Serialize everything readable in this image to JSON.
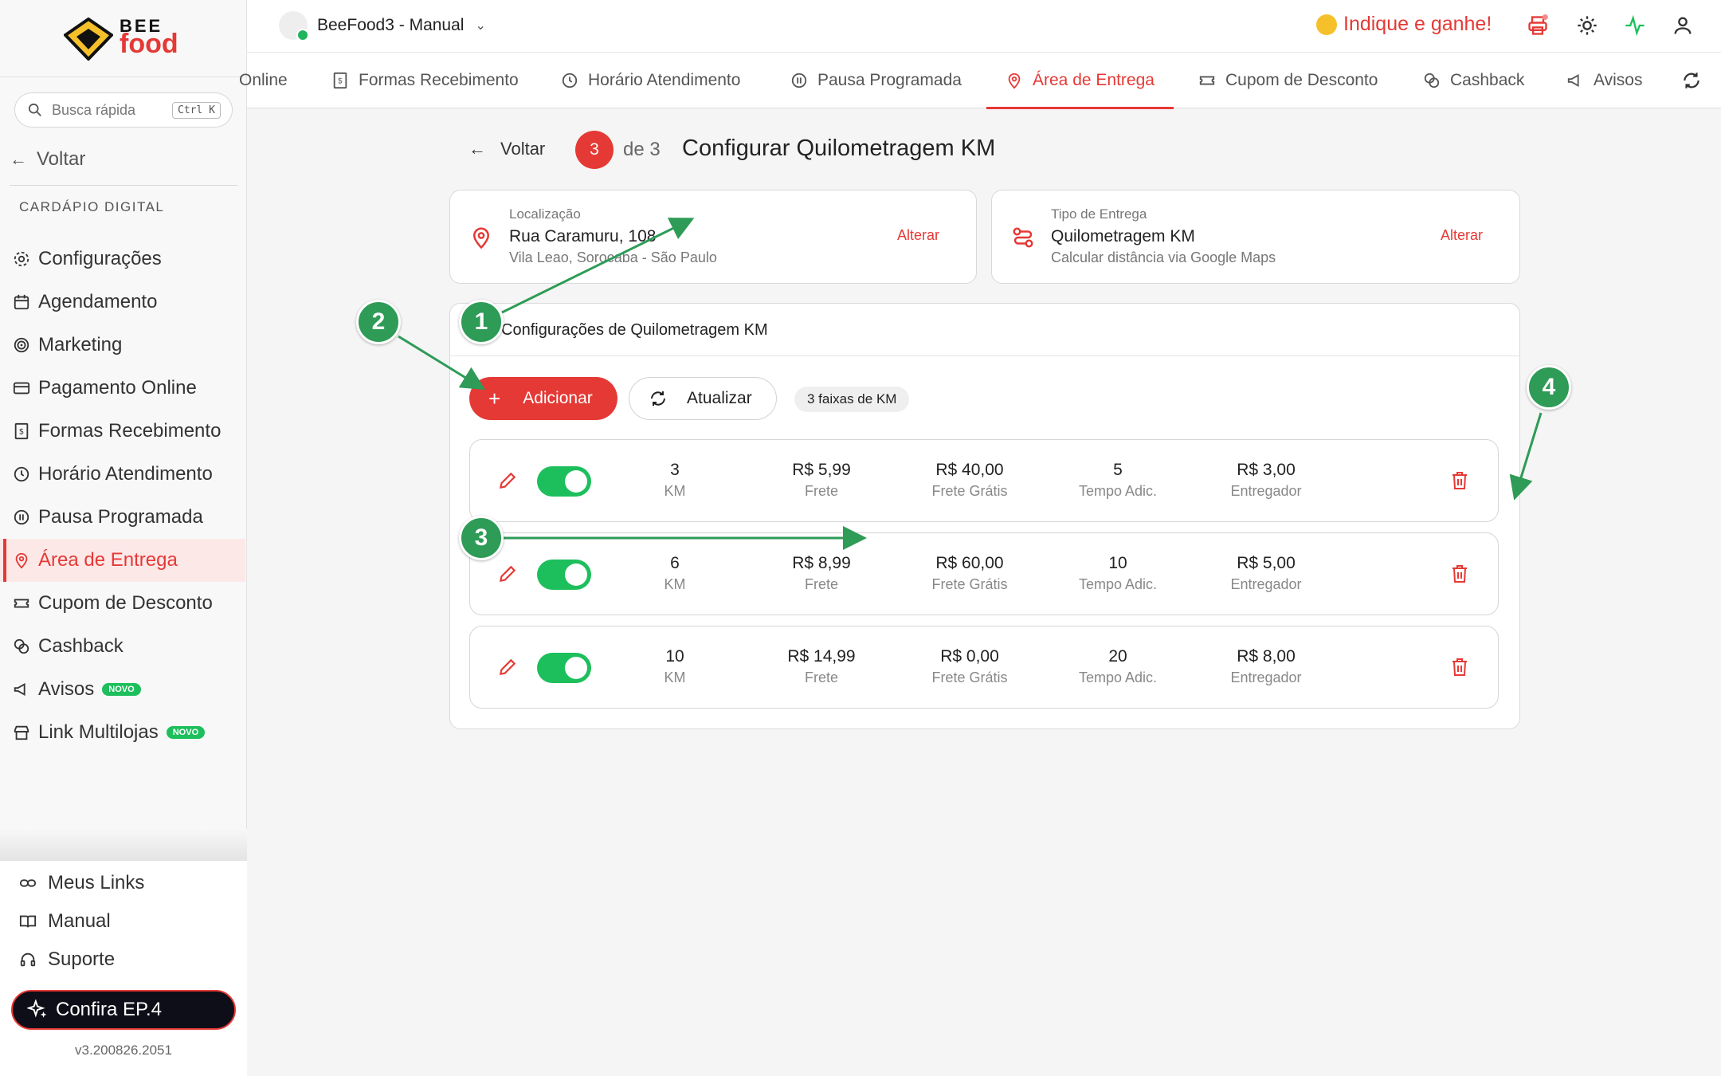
{
  "sidebar": {
    "logo_top": "BEE",
    "logo_bottom": "food",
    "search_placeholder": "Busca rápida",
    "search_shortcut": "Ctrl K",
    "back_label": "Voltar",
    "section_label": "CARDÁPIO DIGITAL",
    "items": [
      {
        "label": "Configurações",
        "icon": "gear-icon"
      },
      {
        "label": "Agendamento",
        "icon": "calendar-icon"
      },
      {
        "label": "Marketing",
        "icon": "target-icon"
      },
      {
        "label": "Pagamento Online",
        "icon": "card-icon"
      },
      {
        "label": "Formas Recebimento",
        "icon": "receipt-icon"
      },
      {
        "label": "Horário Atendimento",
        "icon": "clock-icon"
      },
      {
        "label": "Pausa Programada",
        "icon": "pause-icon"
      },
      {
        "label": "Área de Entrega",
        "icon": "map-pin-icon",
        "active": true
      },
      {
        "label": "Cupom de Desconto",
        "icon": "ticket-icon"
      },
      {
        "label": "Cashback",
        "icon": "coins-icon"
      },
      {
        "label": "Avisos",
        "icon": "megaphone-icon",
        "badge": "NOVO"
      },
      {
        "label": "Link Multilojas",
        "icon": "store-icon",
        "badge": "NOVO"
      }
    ],
    "footer": {
      "links": "Meus Links",
      "manual": "Manual",
      "support": "Suporte",
      "promo": "Confira EP.4",
      "version": "v3.200826.2051"
    }
  },
  "topbar": {
    "store_name": "BeeFood3 - Manual",
    "referral": "Indique e ganhe!"
  },
  "tabs": [
    {
      "label": "Online"
    },
    {
      "label": "Formas Recebimento"
    },
    {
      "label": "Horário Atendimento"
    },
    {
      "label": "Pausa Programada"
    },
    {
      "label": "Área de Entrega",
      "active": true
    },
    {
      "label": "Cupom de Desconto"
    },
    {
      "label": "Cashback"
    },
    {
      "label": "Avisos"
    }
  ],
  "step": {
    "back_label": "Voltar",
    "current": "3",
    "of": "de 3",
    "title": "Configurar Quilometragem KM"
  },
  "location_card": {
    "label": "Localização",
    "value": "Rua Caramuru, 108",
    "sub": "Vila Leao, Sorocaba - São Paulo",
    "action": "Alterar"
  },
  "delivery_card": {
    "label": "Tipo de Entrega",
    "value": "Quilometragem KM",
    "sub": "Calcular distância via Google Maps",
    "action": "Alterar"
  },
  "panel": {
    "title": "Configurações de Quilometragem KM",
    "add_label": "Adicionar",
    "refresh_label": "Atualizar",
    "count_label": "3 faixas de KM",
    "col_labels": [
      "KM",
      "Frete",
      "Frete Grátis",
      "Tempo Adic.",
      "Entregador"
    ],
    "rows": [
      {
        "km": "3",
        "frete": "R$ 5,99",
        "frete_gratis": "R$ 40,00",
        "tempo": "5",
        "entregador": "R$ 3,00",
        "enabled": true
      },
      {
        "km": "6",
        "frete": "R$ 8,99",
        "frete_gratis": "R$ 60,00",
        "tempo": "10",
        "entregador": "R$ 5,00",
        "enabled": true
      },
      {
        "km": "10",
        "frete": "R$ 14,99",
        "frete_gratis": "R$ 0,00",
        "tempo": "20",
        "entregador": "R$ 8,00",
        "enabled": true
      }
    ]
  },
  "annotations": [
    "1",
    "2",
    "3",
    "4"
  ],
  "colors": {
    "accent": "#e53935",
    "success": "#1dbf5c",
    "annotation": "#2e9b57"
  }
}
